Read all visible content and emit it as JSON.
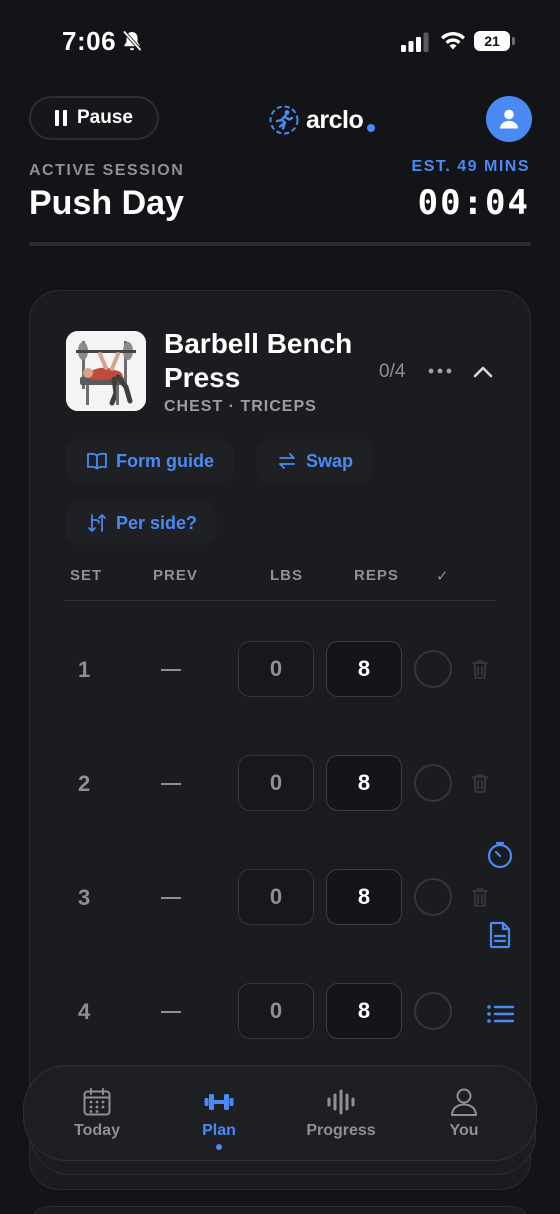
{
  "status_bar": {
    "time": "7:06",
    "battery": "21",
    "icons": [
      "bell-slash-icon",
      "signal-icon",
      "wifi-icon"
    ]
  },
  "header": {
    "pause_label": "Pause",
    "logo_text": "arclo",
    "session_label": "ACTIVE SESSION",
    "session_title": "Push Day",
    "estimate": "EST. 49 MINS",
    "timer": "00:04"
  },
  "exercise": {
    "name": "Barbell Bench Press",
    "muscles": "CHEST · TRICEPS",
    "progress": "0/4",
    "actions": {
      "form_guide": "Form guide",
      "swap": "Swap",
      "per_side": "Per side?"
    },
    "columns": {
      "set": "SET",
      "prev": "PREV",
      "lbs": "LBS",
      "reps": "REPS",
      "done": "✓"
    },
    "sets": [
      {
        "set": "1",
        "lbs": "0",
        "reps": "8"
      },
      {
        "set": "2",
        "lbs": "0",
        "reps": "8"
      },
      {
        "set": "3",
        "lbs": "0",
        "reps": "8"
      },
      {
        "set": "4",
        "lbs": "0",
        "reps": "8"
      }
    ]
  },
  "tabs": [
    {
      "label": "Today"
    },
    {
      "label": "Plan"
    },
    {
      "label": "Progress"
    },
    {
      "label": "You"
    }
  ],
  "colors": {
    "background": "#131417",
    "card": "#1b1c20",
    "accent": "#4a8af4",
    "muted": "#8e9096"
  }
}
